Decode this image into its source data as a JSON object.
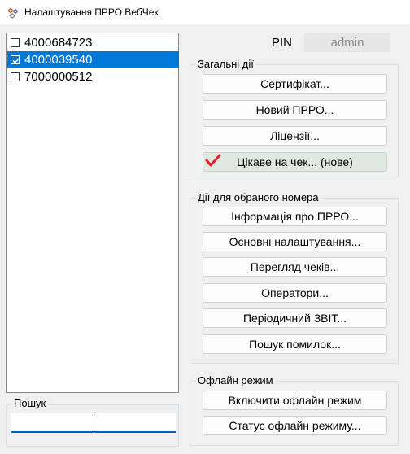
{
  "window": {
    "title": "Налаштування ПРРО ВебЧек"
  },
  "prro_list": [
    {
      "number": "4000684723",
      "checked": false,
      "selected": false
    },
    {
      "number": "4000039540",
      "checked": true,
      "selected": true
    },
    {
      "number": "7000000512",
      "checked": false,
      "selected": false
    }
  ],
  "search": {
    "label": "Пошук",
    "value": ""
  },
  "pin": {
    "label": "PIN",
    "value": "admin"
  },
  "general_actions": {
    "title": "Загальні дії",
    "buttons": [
      "Сертифікат...",
      "Новий ПРРО...",
      "Ліцензії...",
      "Цікаве на чек... (нове)"
    ]
  },
  "selected_actions": {
    "title": "Дії для обраного номера",
    "buttons": [
      "Інформація про ПРРО...",
      "Основні налаштування...",
      "Перегляд чеків...",
      "Оператори...",
      "Періодичний ЗВІТ...",
      "Пошук помилок..."
    ]
  },
  "offline": {
    "title": "Офлайн режим",
    "buttons": [
      "Включити офлайн режим",
      "Статус офлайн режиму..."
    ]
  },
  "colors": {
    "selection": "#0078d7",
    "accent_check": "#e0202e",
    "highlight_button": "#dfe9df"
  }
}
